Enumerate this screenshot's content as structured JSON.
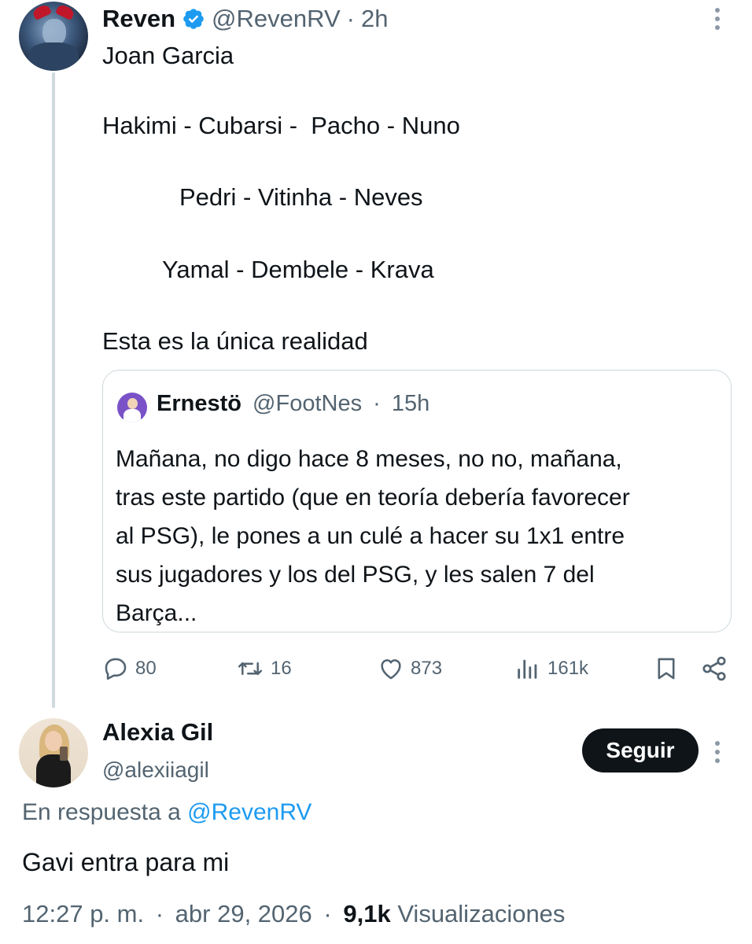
{
  "original_tweet": {
    "display_name": "Reven",
    "handle": "@RevenRV",
    "time": "2h",
    "separator": "·",
    "lines": [
      "Joan Garcia",
      "Hakimi - Cubarsi -  Pacho - Nuno",
      "Pedri - Vitinha - Neves",
      "Yamal - Dembele - Krava",
      "Esta es la única realidad"
    ],
    "verified_icon": "verified-badge-icon",
    "verified_color": "#1d9bf0"
  },
  "quoted_tweet": {
    "display_name": "Ernestö",
    "handle": "@FootNes",
    "time": "15h",
    "separator": "·",
    "body": "Mañana, no digo hace 8 meses, no no, mañana,\ntras este partido (que en teoría debería favorecer\nal PSG), le pones a un culé a hacer su 1x1 entre\nsus jugadores y los del PSG, y les salen 7 del\nBarça..."
  },
  "actions": {
    "replies": "80",
    "retweets": "16",
    "likes": "873",
    "views": "161k"
  },
  "reply_tweet": {
    "display_name": "Alexia Gil",
    "handle": "@alexiiagil",
    "follow_label": "Seguir",
    "reply_prefix": "En respuesta a",
    "reply_target": "@RevenRV",
    "text": "Gavi entra para mi",
    "time": "12:27 p. m.",
    "date": "abr 29, 2026",
    "separator": "·",
    "views_count": "9,1k",
    "views_label": "Visualizaciones"
  },
  "colors": {
    "text_primary": "#0f1419",
    "text_secondary": "#536471",
    "link": "#1d9bf0",
    "border": "#cfd9de"
  }
}
